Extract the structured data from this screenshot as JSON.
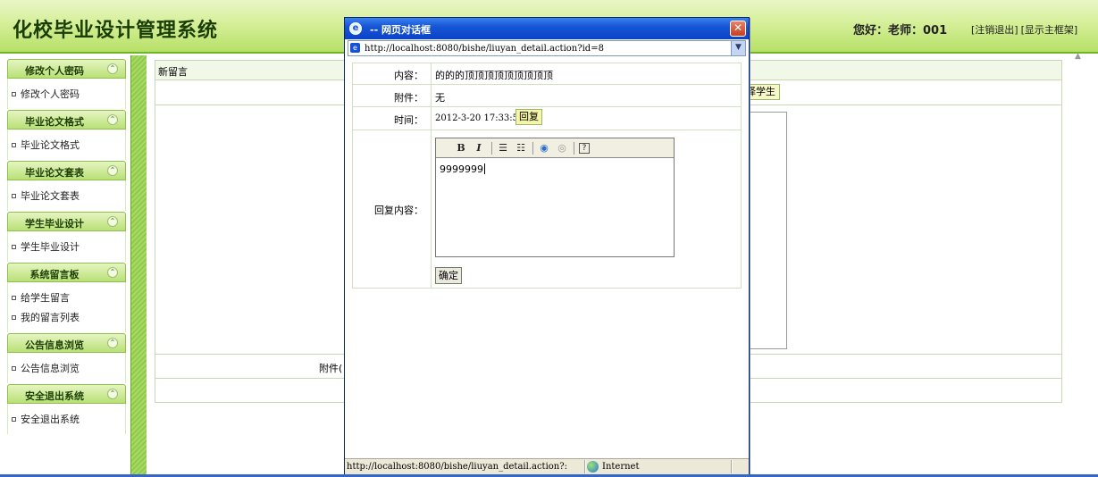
{
  "header": {
    "title": "化校毕业设计管理系统",
    "greeting": "您好：老师：001",
    "logout_link": "[注销退出]",
    "main_frame_link": "[显示主框架]"
  },
  "sidebar": {
    "sections": [
      {
        "title": "修改个人密码",
        "items": [
          "修改个人密码"
        ]
      },
      {
        "title": "毕业论文格式",
        "items": [
          "毕业论文格式"
        ]
      },
      {
        "title": "毕业论文套表",
        "items": [
          "毕业论文套表"
        ]
      },
      {
        "title": "学生毕业设计",
        "items": [
          "学生毕业设计"
        ]
      },
      {
        "title": "系统留言板",
        "items": [
          "给学生留言",
          "我的留言列表"
        ]
      },
      {
        "title": "公告信息浏览",
        "items": [
          "公告信息浏览"
        ]
      },
      {
        "title": "安全退出系统",
        "items": [
          "安全退出系统"
        ]
      }
    ],
    "collapse_glyph": "⌃"
  },
  "main": {
    "header_label": "新留言",
    "select_student_button": "择学生",
    "attachment_label": "附件("
  },
  "dialog": {
    "title": "-- 网页对话框",
    "close_glyph": "✕",
    "address": "http://localhost:8080/bishe/liuyan_detail.action?id=8",
    "fields": {
      "content_label": "内容：",
      "content_value": "的的的顶顶顶顶顶顶顶顶顶",
      "attachment_label": "附件：",
      "attachment_value": "无",
      "time_label": "时间：",
      "time_value": "2012-3-20 17:33:59",
      "reply_button": "回复",
      "reply_content_label": "回复内容：",
      "reply_text": "9999999",
      "ok_button": "确定"
    },
    "toolbar": {
      "bold": "B",
      "italic": "I",
      "ordered_list": "☰",
      "unordered_list": "☷",
      "link": "◉",
      "unlink": "◎",
      "help": "?"
    },
    "status_url": "http://localhost:8080/bishe/liuyan_detail.action?:",
    "status_zone": "Internet"
  }
}
